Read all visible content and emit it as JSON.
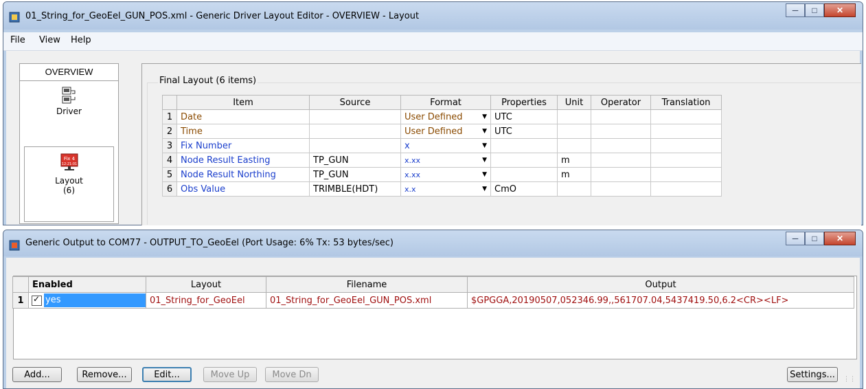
{
  "window1": {
    "title": "01_String_for_GeoEel_GUN_POS.xml - Generic Driver Layout Editor -  OVERVIEW -  Layout",
    "menu": [
      "File",
      "View",
      "Help"
    ],
    "sidebar": {
      "header": "OVERVIEW",
      "items": [
        {
          "label": "Driver"
        },
        {
          "label": "Layout",
          "count": "(6)",
          "icon_text": "Fix 4",
          "icon_subtext": "12:21:01"
        }
      ]
    },
    "group_title": "Final Layout (6 items)",
    "columns": [
      "Item",
      "Source",
      "Format",
      "Properties",
      "Unit",
      "Operator",
      "Translation"
    ],
    "rows": [
      {
        "num": "1",
        "item": "Date",
        "source": "",
        "format": "User Defined",
        "properties": "UTC",
        "unit": "",
        "operator": "",
        "translation": ""
      },
      {
        "num": "2",
        "item": "Time",
        "source": "",
        "format": "User Defined",
        "properties": "UTC",
        "unit": "",
        "operator": "",
        "translation": ""
      },
      {
        "num": "3",
        "item": "Fix Number",
        "source": "",
        "format": "x",
        "properties": "",
        "unit": "",
        "operator": "",
        "translation": ""
      },
      {
        "num": "4",
        "item": "Node Result Easting",
        "source": "TP_GUN",
        "format": "x.xx",
        "properties": "",
        "unit": "m",
        "operator": "",
        "translation": ""
      },
      {
        "num": "5",
        "item": "Node Result Northing",
        "source": "TP_GUN",
        "format": "x.xx",
        "properties": "",
        "unit": "m",
        "operator": "",
        "translation": ""
      },
      {
        "num": "6",
        "item": "Obs Value",
        "source": "TRIMBLE(HDT)",
        "format": "x.x",
        "properties": "CmO",
        "unit": "",
        "operator": "",
        "translation": ""
      }
    ]
  },
  "window2": {
    "title": "Generic Output to COM77 - OUTPUT_TO_GeoEel   (Port Usage: 6% Tx: 53 bytes/sec)",
    "columns": [
      "Enabled",
      "Layout",
      "Filename",
      "Output"
    ],
    "rows": [
      {
        "num": "1",
        "enabled": "yes",
        "layout": "01_String_for_GeoEel",
        "filename": "01_String_for_GeoEel_GUN_POS.xml",
        "output": "$GPGGA,20190507,052346.99,,561707.04,5437419.50,6.2<CR><LF>"
      }
    ],
    "buttons": {
      "add": "Add...",
      "remove": "Remove...",
      "edit": "Edit...",
      "move_up": "Move Up",
      "move_dn": "Move Dn",
      "settings": "Settings..."
    }
  }
}
